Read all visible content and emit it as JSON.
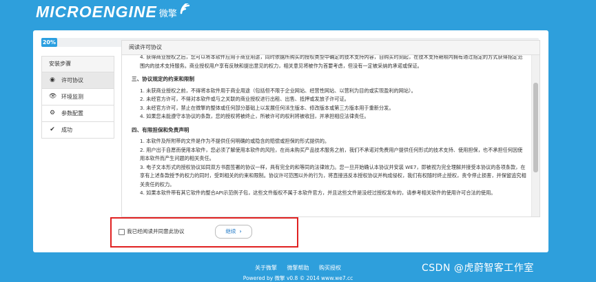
{
  "header": {
    "logo_text": "MICROENGINE",
    "logo_cn": "微擎"
  },
  "progress": {
    "label": "20%",
    "value": 0.2
  },
  "steps": {
    "title": "安装步骤",
    "items": [
      {
        "label": "许可协议",
        "icon": "eye-circle-icon",
        "active": true
      },
      {
        "label": "环境监测",
        "icon": "eye-icon",
        "active": false
      },
      {
        "label": "参数配置",
        "icon": "gear-icon",
        "active": false
      },
      {
        "label": "成功",
        "icon": "check-icon",
        "active": false
      }
    ]
  },
  "license": {
    "header": "阅读许可协议",
    "top_paragraph": "4. 获得商业授权之后，您可以将本软件应用于商业用途，同时依据所购买的授权类型中确定的技术支持内容，自购买时刻起，在技术支持期限内拥有通过指定的方式获得指定范围内的技术支持服务。商业授权用户享有反映和提出意见的权力，相关意见将被作为首要考虑，但没有一定被采纳的承诺或保证。",
    "section3_title": "三、协议规定的约束和限制",
    "section3_items": [
      "1. 未获商业授权之前，不得将本软件用于商业用途（包括但不限于企业网站、经营性网站、以营利为目的或实现盈利的网站）。",
      "2. 未经官方许可，不得对本软件或与之关联的商业授权进行出租、出售、抵押或发放子许可证。",
      "3. 未经官方许可，禁止在微擎的整体或任何部分基础上以发展任何派生版本、修改版本或第三方版本用于重新分发。",
      "4. 如果您未能遵守本协议的条款，您的授权将被终止，所被许可的权利将被收回，并承担相应法律责任。"
    ],
    "section4_title": "四、有限担保和免责声明",
    "section4_items": [
      "1. 本软件及所附带的文件是作为不提供任何明确的或隐含的赔偿或担保的形式提供的。",
      "2. 用户出于自愿而使用本软件，您必须了解使用本软件的风险，在尚未购买产品技术服务之前，我们不承诺对免费用户提供任何形式的技术支持、使用担保，也不承担任何因使用本软件而产生问题的相关责任。",
      "3. 电子文本形式的授权协议如同双方书面签署的协议一样，具有完全的和等同的法律效力。您一旦开始确认本协议并安装 WE7，即被视为完全理解并接受本协议的各项条款，在享有上述条款授予的权力的同时，受到相关的约束和限制。协议许可范围以外的行为，将直接违反本授权协议并构成侵权，我们有权随时终止授权，责令停止损害，并保留追究相关责任的权力。",
      "4. 如果本软件带有其它软件的整合API示范例子包，这些文件版权不属于本软件官方，并且这些文件是没经过授权发布的，请参考相关软件的使用许可合法的使用。"
    ]
  },
  "agree": {
    "label": "我已经阅读并同意此协议",
    "continue_label": "继续"
  },
  "footer": {
    "links": [
      "关于微擎",
      "微擎帮助",
      "购买授权"
    ],
    "powered": "Powered by 微擎 v0.8 © 2014 www.we7.cc"
  },
  "watermark": "CSDN @虎蔚智客工作室"
}
